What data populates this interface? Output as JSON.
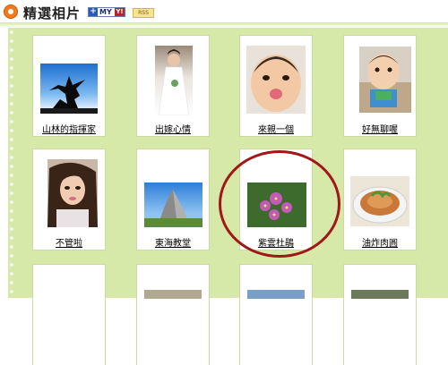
{
  "header": {
    "title": "精選相片",
    "myyahoo": {
      "plus": "+",
      "text": "MY",
      "y": "Y!"
    },
    "rss": "RSS"
  },
  "photos": [
    {
      "caption": "山林的指揮家",
      "subject": "silhouette-tree-icon"
    },
    {
      "caption": "出嫁心情",
      "subject": "bride-photo"
    },
    {
      "caption": "來親一個",
      "subject": "baby-kiss-photo"
    },
    {
      "caption": "好無聊喔",
      "subject": "baby-chair-photo"
    },
    {
      "caption": "不管啦",
      "subject": "girl-portrait-photo"
    },
    {
      "caption": "東海教堂",
      "subject": "church-photo"
    },
    {
      "caption": "紫雲杜鵑",
      "subject": "purple-flower-photo"
    },
    {
      "caption": "油炸肉圓",
      "subject": "fried-meatball-photo"
    }
  ],
  "colors": {
    "panel": "#d6e9a8",
    "highlight": "#a01818",
    "accent": "#f07a1e"
  }
}
